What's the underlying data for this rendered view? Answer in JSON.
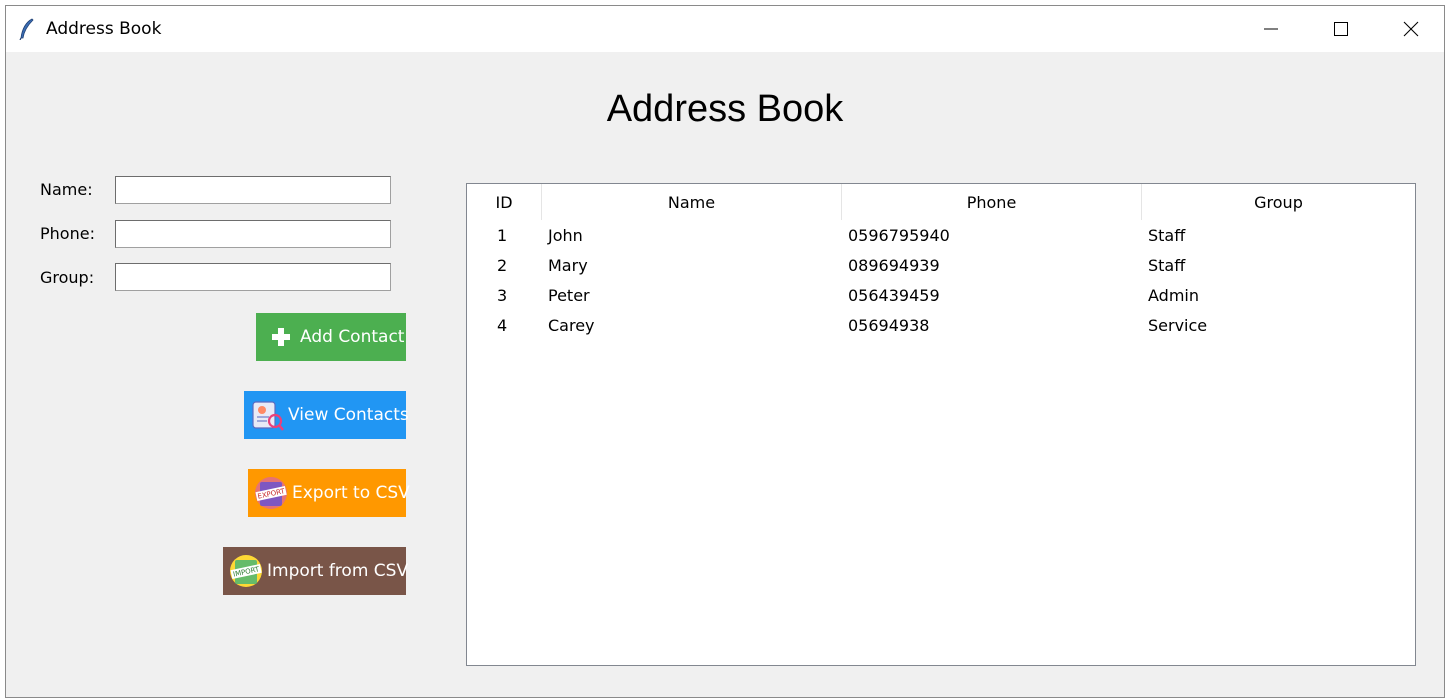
{
  "window": {
    "title": "Address Book",
    "controls": {
      "minimize": "minimize-icon",
      "maximize": "maximize-icon",
      "close": "close-icon"
    }
  },
  "header": {
    "title": "Address Book"
  },
  "form": {
    "name_label": "Name:",
    "phone_label": "Phone:",
    "group_label": "Group:",
    "name_value": "",
    "phone_value": "",
    "group_value": ""
  },
  "buttons": {
    "add": {
      "label": "Add Contact",
      "icon": "plus-icon",
      "color": "#4caf50"
    },
    "view": {
      "label": "View Contacts",
      "icon": "contacts-icon",
      "color": "#2196f3"
    },
    "export": {
      "label": "Export to CSV",
      "icon": "export-icon",
      "color": "#ff9800"
    },
    "import": {
      "label": "Import from CSV",
      "icon": "import-icon",
      "color": "#795548"
    }
  },
  "table": {
    "columns": [
      "ID",
      "Name",
      "Phone",
      "Group"
    ],
    "rows": [
      [
        "1",
        "John",
        "0596795940",
        "Staff"
      ],
      [
        "2",
        "Mary",
        "089694939",
        "Staff"
      ],
      [
        "3",
        "Peter",
        "056439459",
        "Admin"
      ],
      [
        "4",
        "Carey",
        "05694938",
        "Service"
      ]
    ]
  }
}
